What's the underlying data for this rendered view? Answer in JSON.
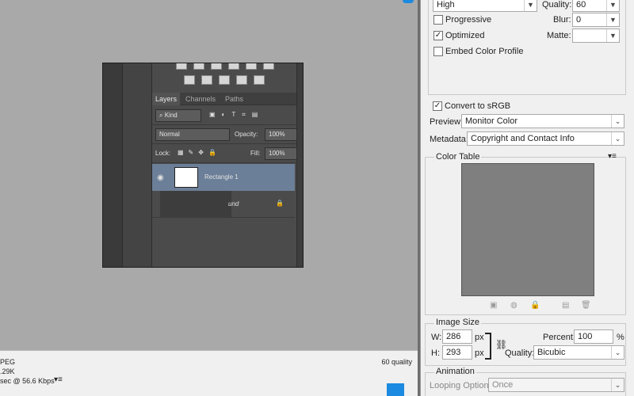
{
  "settings": {
    "compression": "High",
    "quality_label": "Quality:",
    "quality_value": "60",
    "progressive_label": "Progressive",
    "progressive_checked": false,
    "blur_label": "Blur:",
    "blur_value": "0",
    "optimized_label": "Optimized",
    "optimized_checked": true,
    "matte_label": "Matte:",
    "matte_value": "",
    "embed_profile_label": "Embed Color Profile",
    "embed_profile_checked": false,
    "convert_srgb_label": "Convert to sRGB",
    "convert_srgb_checked": true,
    "preview_label": "Preview:",
    "preview_value": "Monitor Color",
    "metadata_label": "Metadata:",
    "metadata_value": "Copyright and Contact Info"
  },
  "color_table": {
    "title": "Color Table",
    "menu_icon": "menu-icon",
    "swatch_color": "#7f7f7f"
  },
  "image_size": {
    "title": "Image Size",
    "w_label": "W:",
    "w_value": "286",
    "h_label": "H:",
    "h_value": "293",
    "unit": "px",
    "percent_label": "Percent:",
    "percent_value": "100",
    "percent_unit": "%",
    "quality_label": "Quality:",
    "quality_value": "Bicubic"
  },
  "animation": {
    "title": "Animation",
    "looping_label": "Looping Options:",
    "looping_value": "Once"
  },
  "status": {
    "format": "PEG",
    "size": ".29K",
    "time": "sec @ 56.6 Kbps",
    "quality": "60 quality"
  },
  "preview_image": {
    "tabs": [
      "Layers",
      "Channels",
      "Paths"
    ],
    "kind_label": "Kind",
    "blend_mode": "Normal",
    "opacity_label": "Opacity:",
    "opacity_value": "100%",
    "lock_label": "Lock:",
    "fill_label": "Fill:",
    "fill_value": "100%",
    "layer1_name": "Rectangle 1",
    "layer2_name": "und"
  },
  "colors": {
    "accent": "#1b8ae0",
    "preview_bg": "#a9a9a9",
    "panel_bg": "#f0f0f0",
    "selected_layer": "#6c7f98"
  }
}
